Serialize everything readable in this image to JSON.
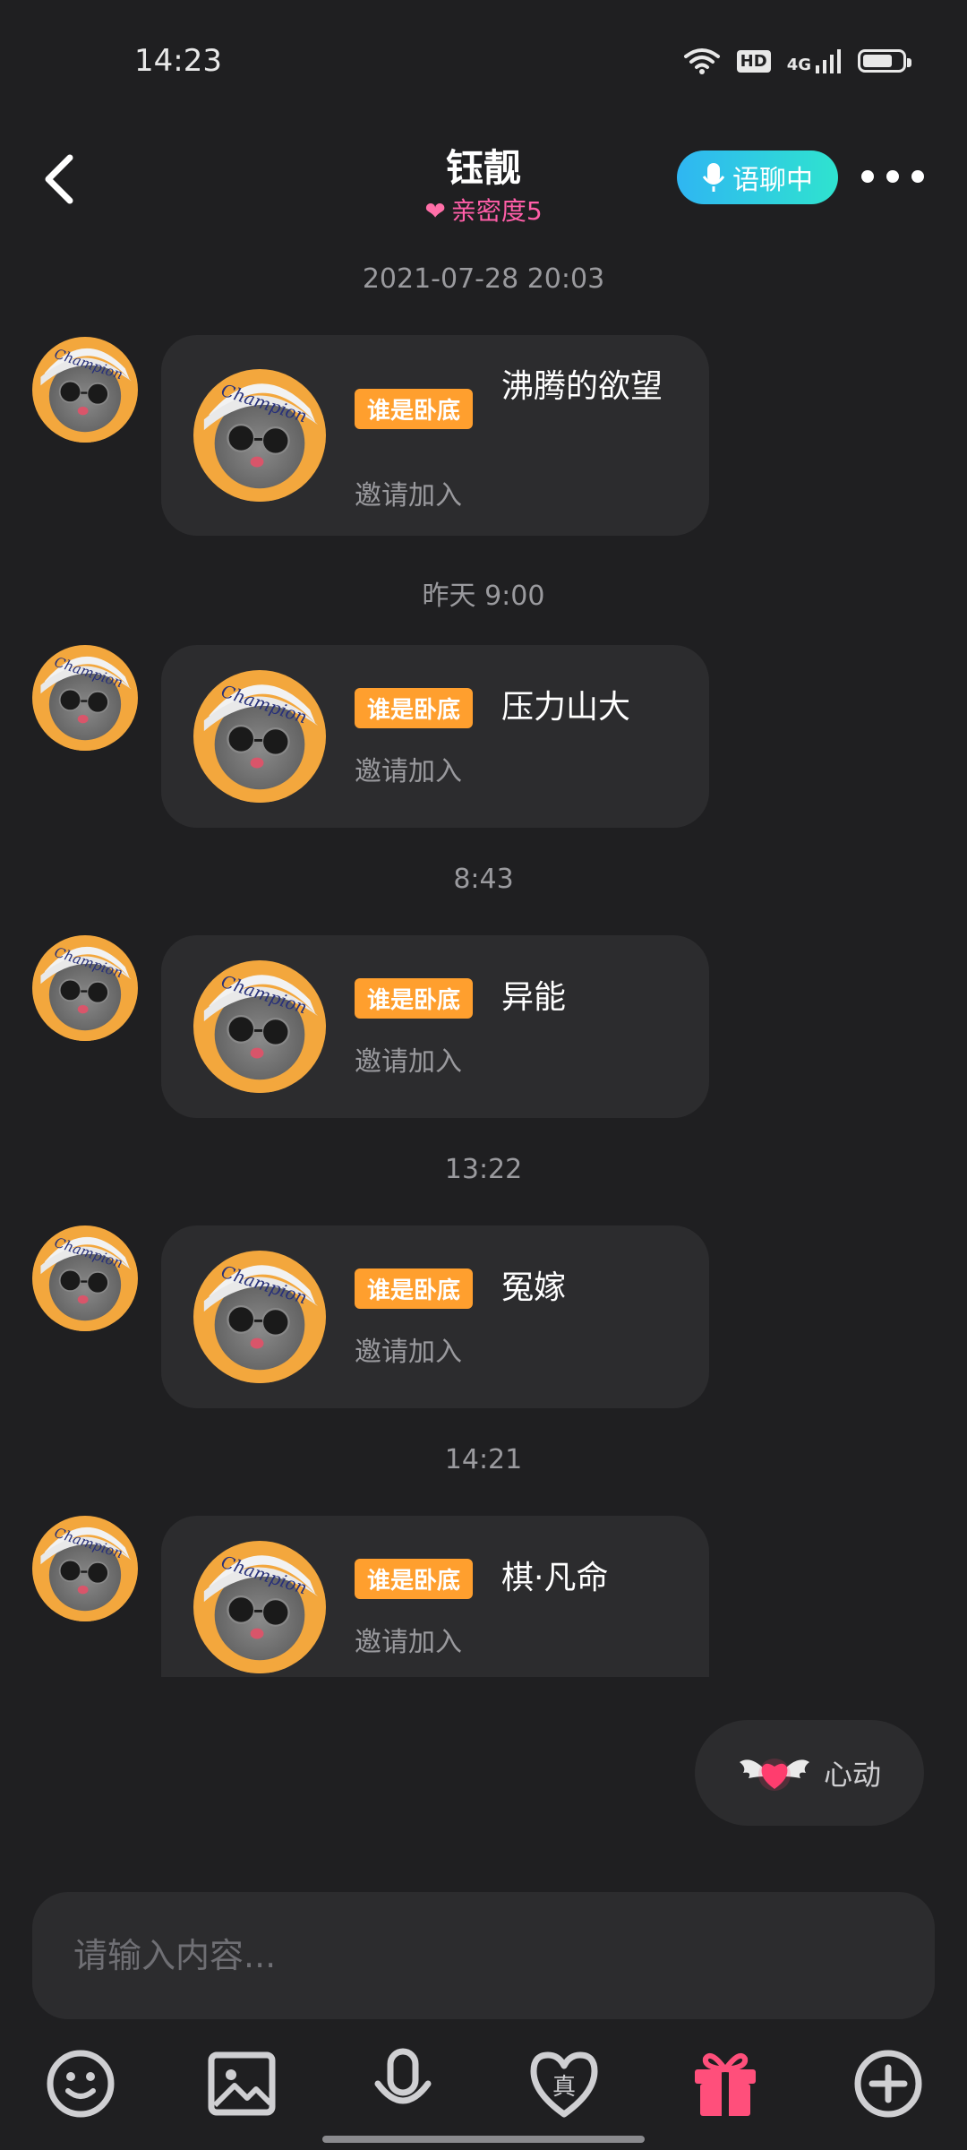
{
  "status_bar": {
    "time": "14:23",
    "hd": "HD",
    "network": "4G",
    "battery_level": 0.75
  },
  "header": {
    "title": "钰靓",
    "intimacy": "亲密度5",
    "voice_chat": "语聊中"
  },
  "messages": [
    {
      "time": "2021-07-28 20:03",
      "tag": "谁是卧底",
      "room": "沸腾的欲望",
      "invite": "邀请加入"
    },
    {
      "time": "昨天 9:00",
      "tag": "谁是卧底",
      "room": "压力山大",
      "invite": "邀请加入"
    },
    {
      "time": "8:43",
      "tag": "谁是卧底",
      "room": "异能",
      "invite": "邀请加入"
    },
    {
      "time": "13:22",
      "tag": "谁是卧底",
      "room": "冤嫁",
      "invite": "邀请加入"
    },
    {
      "time": "14:21",
      "tag": "谁是卧底",
      "room": "棋·凡命",
      "invite": "邀请加入"
    }
  ],
  "heartbeat": {
    "label": "心动"
  },
  "input": {
    "placeholder": "请输入内容..."
  },
  "toolbar": {
    "icons": [
      "emoji-icon",
      "image-icon",
      "microphone-icon",
      "heart-truth-icon",
      "gift-icon",
      "plus-icon"
    ],
    "gift_color": "#ff4f7b",
    "truth_glyph": "真"
  },
  "colors": {
    "background": "#1f1f21",
    "bubble": "#2c2c2e",
    "tag": "#ff9f2e",
    "intimacy": "#ff5ea8",
    "voice_gradient": [
      "#2fb6f2",
      "#2fe3cf"
    ]
  }
}
